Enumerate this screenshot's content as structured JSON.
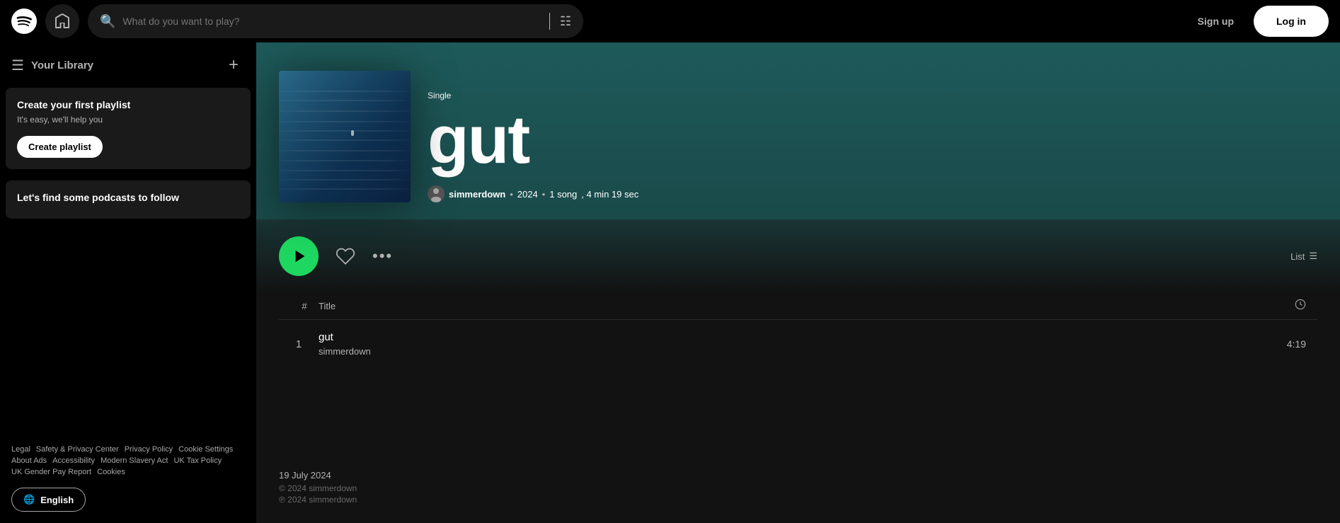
{
  "header": {
    "search_placeholder": "What do you want to play?",
    "signup_label": "Sign up",
    "login_label": "Log in"
  },
  "sidebar": {
    "library_title": "Your Library",
    "create_playlist_card": {
      "title": "Create your first playlist",
      "subtitle": "It's easy, we'll help you",
      "button_label": "Create playlist"
    },
    "podcasts_card": {
      "title": "Let's find some podcasts to follow"
    },
    "footer": {
      "links": [
        "Legal",
        "Safety & Privacy Center",
        "Privacy Policy",
        "Cookie Settings",
        "About Ads",
        "Accessibility",
        "Modern Slavery Act",
        "UK Tax Policy",
        "UK Gender Pay Report",
        "Cookies"
      ],
      "language_button": "English"
    }
  },
  "album": {
    "type": "Single",
    "title": "gut",
    "artist": "simmerdown",
    "year": "2024",
    "song_count": "1 song",
    "duration": "4 min 19 sec",
    "controls": {
      "list_label": "List"
    },
    "tracks": [
      {
        "number": "1",
        "title": "gut",
        "artist": "simmerdown",
        "duration": "4:19"
      }
    ],
    "release_date": "19 July 2024",
    "copyright_p": "© 2024 simmerdown",
    "copyright_c": "℗ 2024 simmerdown"
  }
}
